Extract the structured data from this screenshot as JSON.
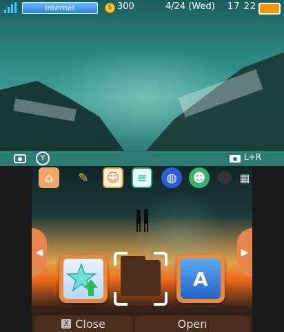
{
  "status_bar": {
    "connection_label": "Internet",
    "coins": "300",
    "date": "4/24 (Wed)",
    "time": "17 22",
    "battery_color": "#f39400"
  },
  "strip": {
    "left_icons": [
      "camera-icon",
      "y-button-icon"
    ],
    "right_icons": [
      "camera-icon",
      "l-plus-r-icon"
    ],
    "right_label": "L+R",
    "y_label": "Y"
  },
  "toolbar": {
    "items": [
      {
        "icon": "settings-home-icon"
      },
      {
        "icon": "pencil-icon"
      },
      {
        "icon": "smiley-icon"
      },
      {
        "icon": "speech-bubble-icon"
      },
      {
        "icon": "globe-icon"
      },
      {
        "icon": "people-icon"
      },
      {
        "icon": "dot-icon"
      },
      {
        "icon": "grid-icon"
      }
    ]
  },
  "apps": [
    {
      "icon": "star-update-icon"
    },
    {
      "icon": "folder-icon",
      "selected": true
    },
    {
      "icon": "letter-a-icon",
      "label": "A"
    }
  ],
  "bottom_bar": {
    "close_label": "Close",
    "close_key": "X",
    "open_label": "Open"
  }
}
